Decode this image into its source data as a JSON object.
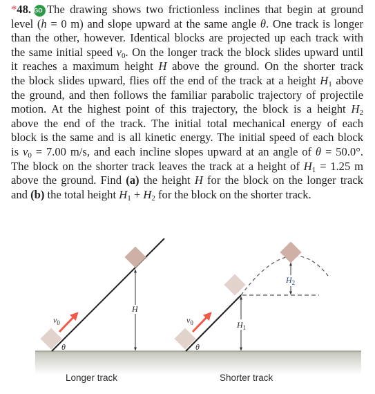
{
  "problem": {
    "star": "*",
    "number": "48.",
    "badge": "GO",
    "lines": [
      [
        "The drawing shows two frictionless inclines that begin at ground"
      ],
      [
        "level (",
        "h",
        " = 0 m) and slope upward at the same angle ",
        "θ",
        ". One track is longer"
      ],
      [
        "than the other, however. Identical blocks are projected up each track with"
      ],
      [
        "the same initial speed ",
        "v",
        "0",
        ". On the longer track the block slides upward until"
      ],
      [
        "it reaches a maximum height ",
        "H",
        " above the ground. On the shorter track"
      ],
      [
        "the block slides upward, flies off the end of the track at a height ",
        "H",
        "1",
        " above"
      ],
      [
        "the ground, and then follows the familiar parabolic trajectory of projectile"
      ],
      [
        "motion. At the highest point of this trajectory, the block is a height ",
        "H",
        "2"
      ],
      [
        "above the end of the track. The initial total mechanical energy of each"
      ],
      [
        "block is the same and is all kinetic energy. The initial speed of each block"
      ],
      [
        "is ",
        "v",
        "0",
        " = 7.00 m/s, and each incline slopes upward at an angle of ",
        "θ",
        " = 50.0°."
      ],
      [
        "The block on the shorter track leaves the track at a height of ",
        "H",
        "1",
        " = 1.25 m"
      ],
      [
        "above the ground. Find ",
        "(a)",
        " the height ",
        "H",
        " for the block on the longer track"
      ],
      [
        "and ",
        "(b)",
        " the total height ",
        "H",
        "1",
        " + ",
        "H",
        "2",
        " for the block on the shorter track."
      ]
    ]
  },
  "given": {
    "v0": "7.00 m/s",
    "theta": "50.0°",
    "H1": "1.25 m",
    "h_start": "0 m"
  },
  "figure": {
    "longer_track": {
      "caption": "Longer track",
      "v0_label": "v0",
      "theta_label": "θ",
      "height_label": "H"
    },
    "shorter_track": {
      "caption": "Shorter track",
      "v0_label": "v0",
      "theta_label": "θ",
      "height1_label": "H1",
      "height2_label": "H2"
    },
    "colors": {
      "block": "#e2d2cc",
      "block_top": "#cfb0a6",
      "arrow": "#ef5a4a",
      "ground": "#c9cbc0",
      "track": "#1e1e1e"
    }
  }
}
